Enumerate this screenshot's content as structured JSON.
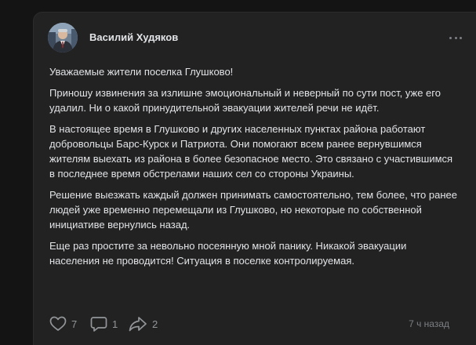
{
  "post": {
    "author": "Василий Худяков",
    "avatar_icon": "user-photo-icon",
    "menu_icon": "more-horizontal-icon",
    "paragraphs": [
      "Уважаемые жители поселка Глушково!",
      "Приношу извинения за излишне эмоциональный и неверный по сути пост, уже его удалил. Ни о какой принудительной эвакуации жителей речи не идёт.",
      "В настоящее время в Глушково и других населенных пунктах района работают добровольцы Барс-Курск и Патриота. Они помогают всем ранее вернувшимся жителям выехать из района в более безопасное место. Это связано с участившимся в последнее время обстрелами наших сел со стороны Украины.",
      "Решение выезжать каждый должен принимать самостоятельно, тем более, что ранее людей уже временно перемещали из Глушково, но некоторые по собственной инициативе вернулись назад.",
      "Еще раз простите за невольно посеянную мной панику. Никакой эвакуации населения не проводится! Ситуация в поселке контролируемая."
    ],
    "actions": {
      "likes": "7",
      "comments": "1",
      "shares": "2"
    },
    "time": "7 ч назад"
  },
  "colors": {
    "page_bg": "#141414",
    "card_bg": "#222222",
    "text": "#e1e3e6",
    "muted": "#939699"
  }
}
